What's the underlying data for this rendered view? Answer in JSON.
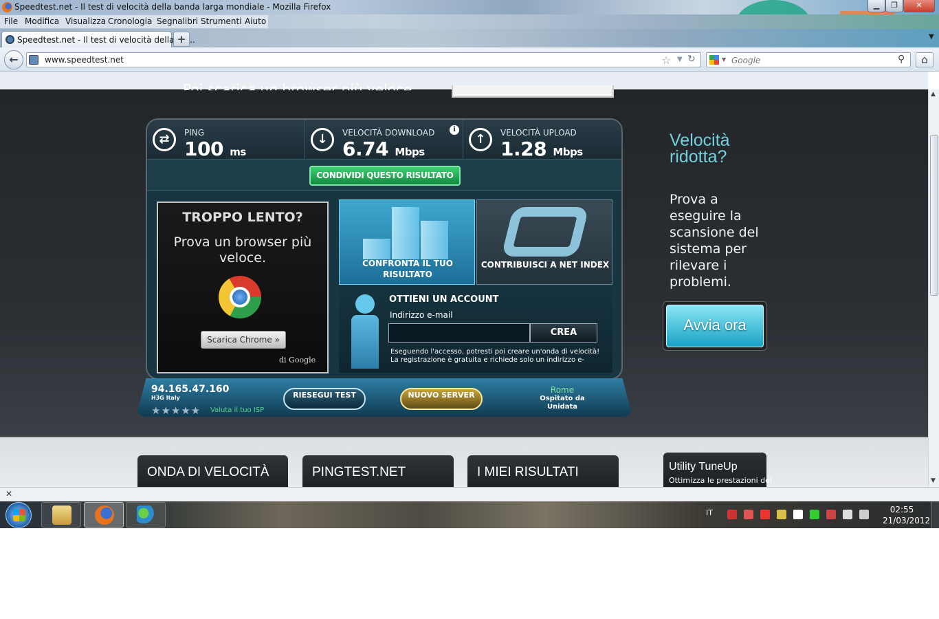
{
  "window": {
    "title": "Speedtest.net - Il test di velocità della banda larga mondiale - Mozilla Firefox"
  },
  "menu": [
    "File",
    "Modifica",
    "Visualizza",
    "Cronologia",
    "Segnalibri",
    "Strumenti",
    "Aiuto"
  ],
  "tab": {
    "label": "Speedtest.net - Il test di velocità della ba...",
    "new_tab": "+"
  },
  "nav": {
    "url": "www.speedtest.net",
    "search_placeholder": "Google"
  },
  "page": {
    "cut_banner_text": "Poi scarica un browser più veloce.",
    "stats": {
      "ping_label": "PING",
      "ping_value": "100",
      "ping_unit": "ms",
      "download_label": "VELOCITÀ DOWNLOAD",
      "download_value": "6.74",
      "download_unit": "Mbps",
      "upload_label": "VELOCITÀ UPLOAD",
      "upload_value": "1.28",
      "upload_unit": "Mbps"
    },
    "share_button": "CONDIVIDI QUESTO RISULTATO",
    "chrome_ad": {
      "title": "TROPPO LENTO?",
      "text": "Prova un browser più veloce.",
      "button": "Scarica Chrome",
      "button_arrow": "»",
      "by": "di Google"
    },
    "tiles": {
      "compare": "CONFRONTA IL TUO RISULTATO",
      "netindex": "CONTRIBUISCI A NET INDEX"
    },
    "account": {
      "title": "OTTIENI UN ACCOUNT",
      "email_label": "Indirizzo e-mail",
      "email_value": "",
      "create_button": "CREA",
      "fine_line1": "Eseguendo l'accesso, potresti poi creare un'onda di velocità!",
      "fine_line2": "La registrazione è gratuita e richiede solo un indirizzo e-"
    },
    "isp": {
      "ip": "94.165.47.160",
      "carrier": "H3G Italy",
      "stars": "★★★★★",
      "rating": 0,
      "rate_link": "Valuta il tuo ISP"
    },
    "retest_button": "RIESEGUI TEST",
    "new_server_button": "NUOVO SERVER",
    "server": {
      "city": "Rome",
      "host": "Ospitato da Unidata"
    },
    "sidebar": {
      "title": "Velocità ridotta?",
      "text": "Prova a eseguire la scansione del sistema per rilevare i problemi.",
      "button": "Avvia ora"
    },
    "cards": [
      "ONDA DI VELOCITÀ",
      "PINGTEST.NET",
      "I MIEI RISULTATI"
    ],
    "utility": {
      "title": "Utility TuneUp",
      "subtitle": "Ottimizza le prestazioni del"
    }
  },
  "taskbar": {
    "language": "IT",
    "time": "02:55",
    "date": "21/03/2012"
  },
  "colors": {
    "accent_green": "#3ed073",
    "accent_cyan": "#74d0dd",
    "panel_bg": "#173642"
  }
}
